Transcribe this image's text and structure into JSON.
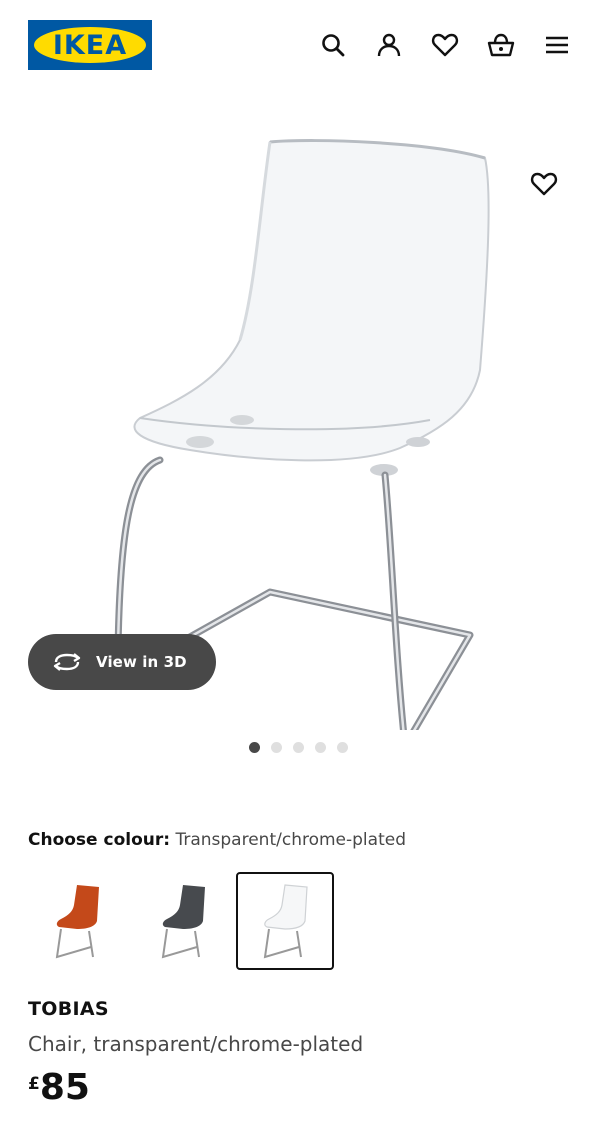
{
  "header": {
    "logo_text": "IKEA",
    "icons": [
      "search-icon",
      "account-icon",
      "favourites-icon",
      "basket-icon",
      "menu-icon"
    ]
  },
  "gallery": {
    "view_3d_label": "View in 3D",
    "image_count": 5,
    "active_image": 1
  },
  "colour": {
    "label": "Choose colour:",
    "value": "Transparent/chrome-plated",
    "options": [
      "orange",
      "dark-grey",
      "transparent"
    ],
    "selected": "transparent"
  },
  "product": {
    "name": "TOBIAS",
    "description": "Chair, transparent/chrome-plated",
    "currency": "£",
    "price": "85"
  },
  "colors": {
    "brand_blue": "#0058a3",
    "brand_yellow": "#ffdb00",
    "button_dark": "#484848"
  }
}
